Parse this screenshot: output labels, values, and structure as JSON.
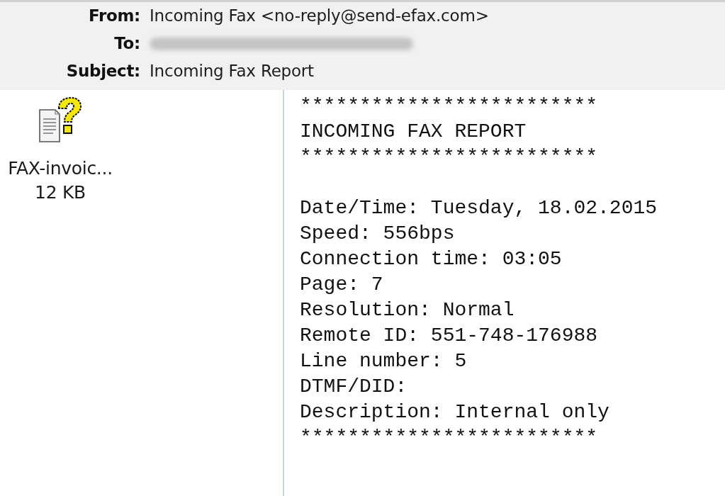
{
  "header": {
    "fields": [
      {
        "label": "From:",
        "value": "Incoming Fax <no-reply@send-efax.com>",
        "redacted": false
      },
      {
        "label": "To:",
        "redacted": true
      },
      {
        "label": "Subject:",
        "value": "Incoming Fax Report",
        "redacted": false
      }
    ]
  },
  "attachments": [
    {
      "name": "FAX-invoic...",
      "size": "12 KB"
    }
  ],
  "body": {
    "paragraphs": [
      [
        "*************************",
        "INCOMING FAX REPORT",
        "*************************"
      ],
      [
        "Date/Time: Tuesday, 18.02.2015",
        "Speed: 556bps",
        "Connection time: 03:05",
        "Page: 7",
        "Resolution: Normal",
        "Remote ID: 551-748-176988",
        "Line number: 5",
        "DTMF/DID:",
        "Description: Internal only",
        "*************************"
      ]
    ]
  }
}
